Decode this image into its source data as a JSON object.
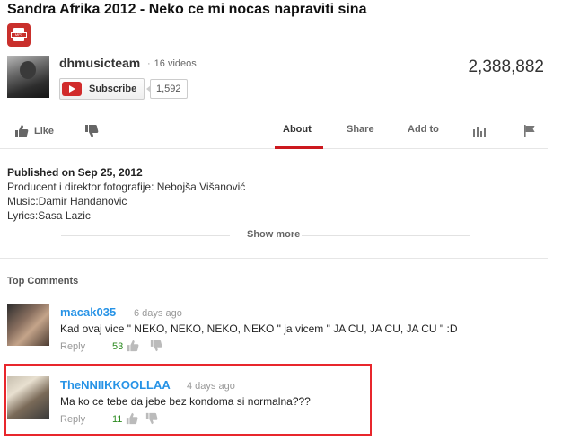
{
  "video": {
    "title": "Sandra Afrika 2012 - Neko ce mi nocas napraviti sina",
    "views": "2,388,882"
  },
  "channel": {
    "name": "dhmusicteam",
    "video_count": "16 videos",
    "subscribe_label": "Subscribe",
    "subscriber_count": "1,592"
  },
  "actions": {
    "like_label": "Like",
    "tabs": [
      "About",
      "Share",
      "Add to"
    ],
    "active_tab": "About"
  },
  "description": {
    "published": "Published on Sep 25, 2012",
    "lines": [
      "Producent i direktor fotografije: Nebojša Višanović",
      "Music:Damir Handanovic",
      "Lyrics:Sasa Lazic"
    ],
    "show_more": "Show more"
  },
  "comments_section": {
    "heading": "Top Comments",
    "comments": [
      {
        "author": "macak035",
        "time": "6 days ago",
        "text": "Kad ovaj vice \" NEKO, NEKO, NEKO, NEKO \" ja vicem \" JA CU, JA CU, JA CU \" :D",
        "reply_label": "Reply",
        "likes": "53"
      },
      {
        "author": "TheNNIIKKOOLLAA",
        "time": "4 days ago",
        "text": "Ma ko ce tebe da jebe bez kondoma si normalna???",
        "reply_label": "Reply",
        "likes": "11"
      }
    ]
  },
  "colors": {
    "accent_red": "#cc181e",
    "highlight_border": "#e8262c",
    "author_link": "#2793e6",
    "likes_green": "#2b8a1f"
  }
}
